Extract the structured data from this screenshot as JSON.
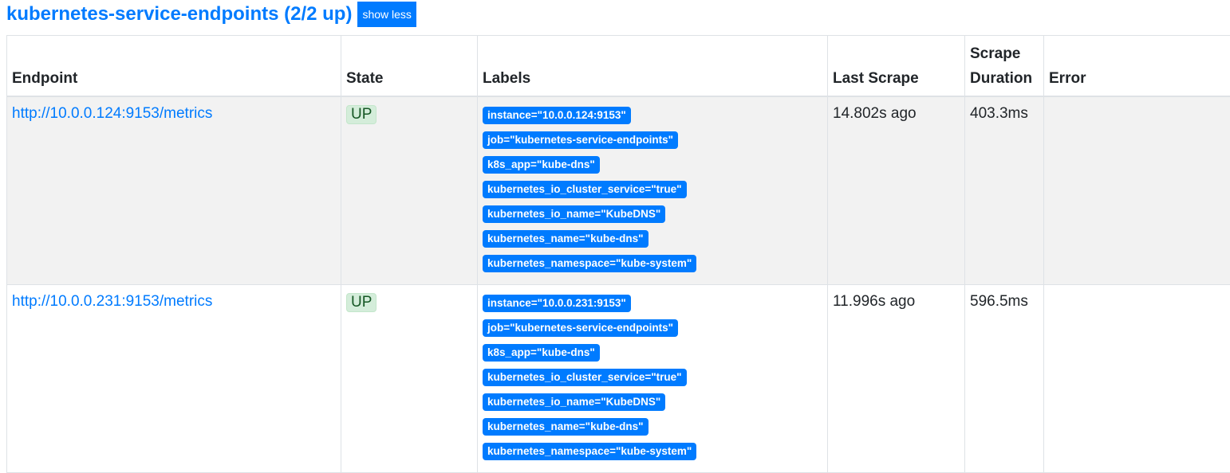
{
  "job": {
    "title": "kubernetes-service-endpoints (2/2 up)",
    "toggle_label": "show less"
  },
  "columns": [
    "Endpoint",
    "State",
    "Labels",
    "Last Scrape",
    "Scrape Duration",
    "Error"
  ],
  "colors": {
    "accent": "#007bff",
    "up_bg": "#d4edda",
    "up_text": "#155724"
  },
  "rows": [
    {
      "endpoint": "http://10.0.0.124:9153/metrics",
      "state": "UP",
      "labels": [
        "instance=\"10.0.0.124:9153\"",
        "job=\"kubernetes-service-endpoints\"",
        "k8s_app=\"kube-dns\"",
        "kubernetes_io_cluster_service=\"true\"",
        "kubernetes_io_name=\"KubeDNS\"",
        "kubernetes_name=\"kube-dns\"",
        "kubernetes_namespace=\"kube-system\""
      ],
      "last_scrape": "14.802s ago",
      "duration": "403.3ms",
      "error": ""
    },
    {
      "endpoint": "http://10.0.0.231:9153/metrics",
      "state": "UP",
      "labels": [
        "instance=\"10.0.0.231:9153\"",
        "job=\"kubernetes-service-endpoints\"",
        "k8s_app=\"kube-dns\"",
        "kubernetes_io_cluster_service=\"true\"",
        "kubernetes_io_name=\"KubeDNS\"",
        "kubernetes_name=\"kube-dns\"",
        "kubernetes_namespace=\"kube-system\""
      ],
      "last_scrape": "11.996s ago",
      "duration": "596.5ms",
      "error": ""
    }
  ]
}
